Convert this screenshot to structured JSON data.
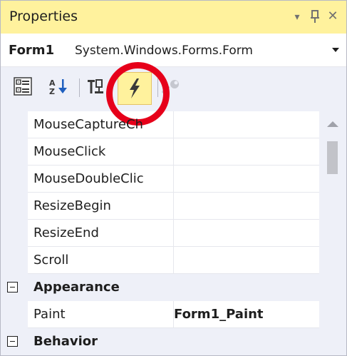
{
  "window": {
    "title": "Properties",
    "dropdown_glyph": "▾",
    "pin_glyph": "ꟼ",
    "close_glyph": "✕"
  },
  "object_selector": {
    "name": "Form1",
    "type": "System.Windows.Forms.Form"
  },
  "toolbar": {
    "buttons": [
      {
        "name": "categorized-icon"
      },
      {
        "name": "alphabetical-icon"
      },
      {
        "name": "properties-icon"
      },
      {
        "name": "events-icon",
        "active": true
      },
      {
        "name": "property-pages-icon",
        "enabled": false
      }
    ],
    "highlight_color": "#fff29d",
    "annotation_color": "#e6001a"
  },
  "grid": {
    "rows": [
      {
        "name": "MouseCaptureCh",
        "value": ""
      },
      {
        "name": "MouseClick",
        "value": ""
      },
      {
        "name": "MouseDoubleClic",
        "value": ""
      },
      {
        "name": "ResizeBegin",
        "value": ""
      },
      {
        "name": "ResizeEnd",
        "value": ""
      },
      {
        "name": "Scroll",
        "value": ""
      }
    ],
    "categories": [
      {
        "label": "Appearance",
        "rows": [
          {
            "name": "Paint",
            "value": "Form1_Paint"
          }
        ]
      },
      {
        "label": "Behavior",
        "rows": []
      }
    ]
  }
}
